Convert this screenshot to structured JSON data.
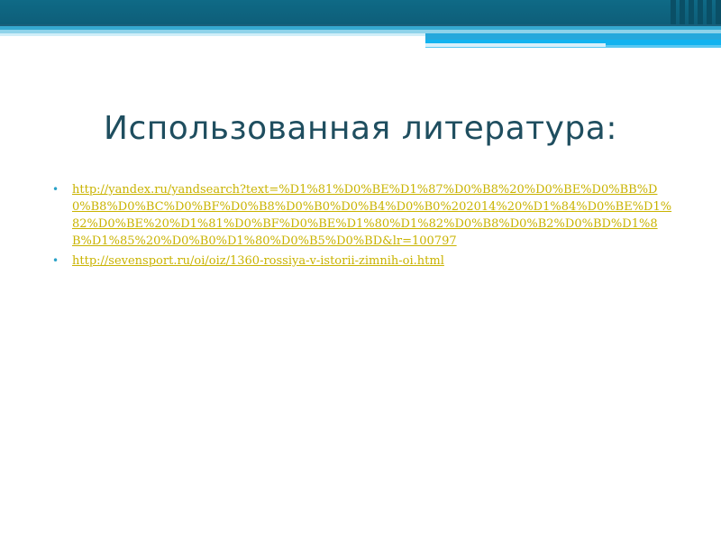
{
  "slide": {
    "title": "Использованная литература:",
    "links": [
      {
        "text": "http://yandex.ru/yandsearch?text=%D1%81%D0%BE%D1%87%D0%B8%20%D0%BE%D0%BB%D0%B8%D0%BC%D0%BF%D0%B8%D0%B0%D0%B4%D0%B0%202014%20%D1%84%D0%BE%D1%82%D0%BE%20%D1%81%D0%BF%D0%BE%D1%80%D1%82%D0%B8%D0%B2%D0%BD%D1%8B%D1%85%20%D0%B0%D1%80%D0%B5%D0%BD&lr=100797"
      },
      {
        "text": "http://sevensport.ru/oi/oiz/1360-rossiya-v-istorii-zimnih-oi.html"
      }
    ],
    "bullet_glyph": "•"
  },
  "colors": {
    "header_dark": "#0f6a86",
    "header_accent": "#26a8dc",
    "title": "#1f4e5f",
    "link": "#c9b300",
    "bullet": "#2aa2c8"
  }
}
